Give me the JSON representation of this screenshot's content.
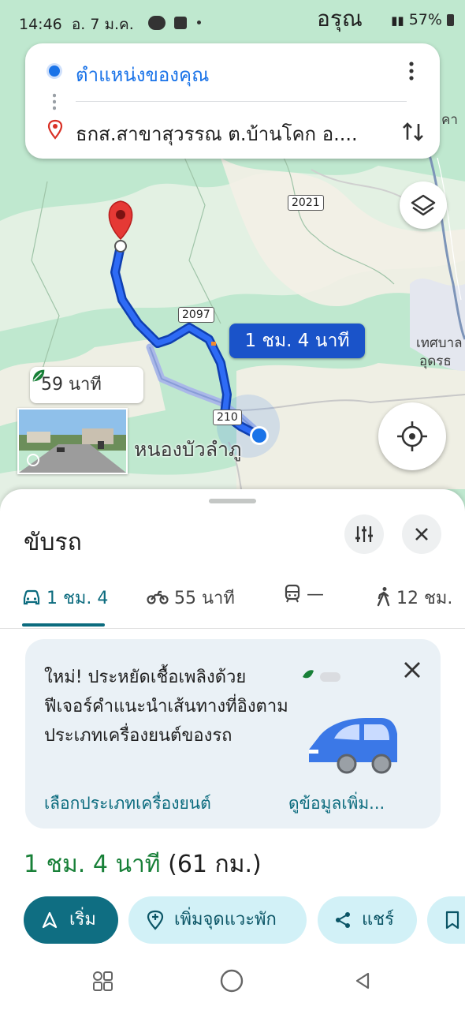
{
  "status_bar": {
    "time": "14:46",
    "date": "อ. 7 ม.ค.",
    "battery": "57%",
    "map_top_label": "อรุณ"
  },
  "directions_card": {
    "origin": "ตำแหน่งของคุณ",
    "destination": "ธกส.สาขาสุวรรณ ต.บ้านโคก อ...."
  },
  "map": {
    "shields": [
      "2021",
      "2097",
      "210"
    ],
    "eta_selected": "1 ชม. 4 นาที",
    "eta_alternate": "59 นาที",
    "place_label": "หนองบัวลำภู",
    "side_labels": [
      "เทศบาล",
      "อุดรธ",
      "คา"
    ]
  },
  "sheet": {
    "title": "ขับรถ",
    "tabs": [
      {
        "label": "1 ชม. 4",
        "icon": "car-icon"
      },
      {
        "label": "55 นาที",
        "icon": "motorbike-icon"
      },
      {
        "label": "—",
        "icon": "transit-icon"
      },
      {
        "label": "12 ชม.",
        "icon": "walk-icon"
      }
    ],
    "promo": {
      "text": "ใหม่! ประหยัดเชื้อเพลิงด้วยฟีเจอร์คำแนะนำเส้นทางที่อิงตามประเภทเครื่องยนต์ของรถ",
      "link_engine": "เลือกประเภทเครื่องยนต์",
      "link_more": "ดูข้อมูลเพิ่ม..."
    },
    "summary_duration": "1 ชม. 4 นาที",
    "summary_distance": "(61 กม.)",
    "actions": {
      "start": "เริ่ม",
      "add_stop": "เพิ่มจุดแวะพัก",
      "share": "แชร์"
    }
  },
  "colors": {
    "route_blue": "#1a53c9",
    "accent_teal": "#0f6e82",
    "eco_green": "#188038"
  }
}
